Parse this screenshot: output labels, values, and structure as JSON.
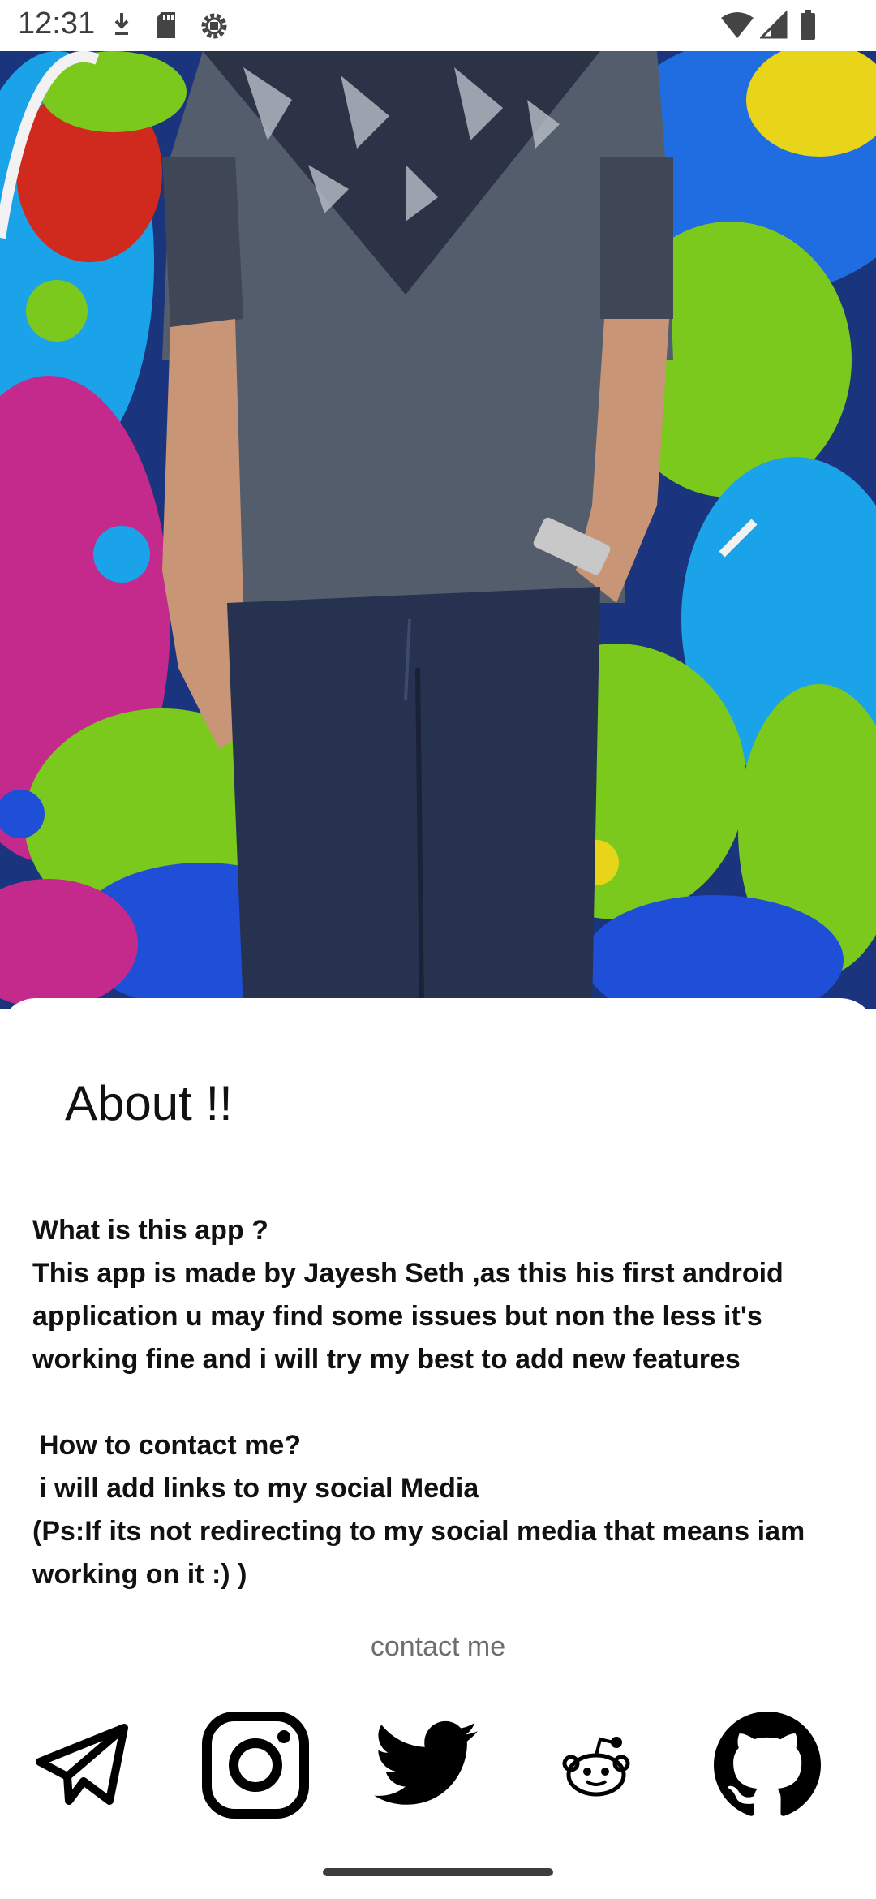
{
  "status_bar": {
    "time": "12:31",
    "left_icons": [
      "download-icon",
      "sd-card-icon",
      "settings-icon"
    ],
    "right_icons": [
      "wifi-icon",
      "signal-icon",
      "battery-icon"
    ]
  },
  "hero": {
    "image": "photo-of-person-against-graffiti-wall"
  },
  "about": {
    "title": "About !!",
    "q1": "What is this app ?",
    "a1": "This app is made by Jayesh Seth ,as this his first android application u may find some issues but non the less it's working fine and i will try my best to add new features",
    "q2": "How to contact me?",
    "a2": "i will add links to my social Media",
    "a3": "(Ps:If its not redirecting to my social media that means iam working on it :) )"
  },
  "contact": {
    "label": "contact me",
    "links": [
      {
        "name": "telegram",
        "icon": "telegram-icon"
      },
      {
        "name": "instagram",
        "icon": "instagram-icon"
      },
      {
        "name": "twitter",
        "icon": "twitter-icon"
      },
      {
        "name": "reddit",
        "icon": "reddit-icon"
      },
      {
        "name": "github",
        "icon": "github-icon"
      }
    ]
  },
  "colors": {
    "text": "#111111",
    "muted": "#6e6e6e",
    "sheet": "#ffffff"
  }
}
